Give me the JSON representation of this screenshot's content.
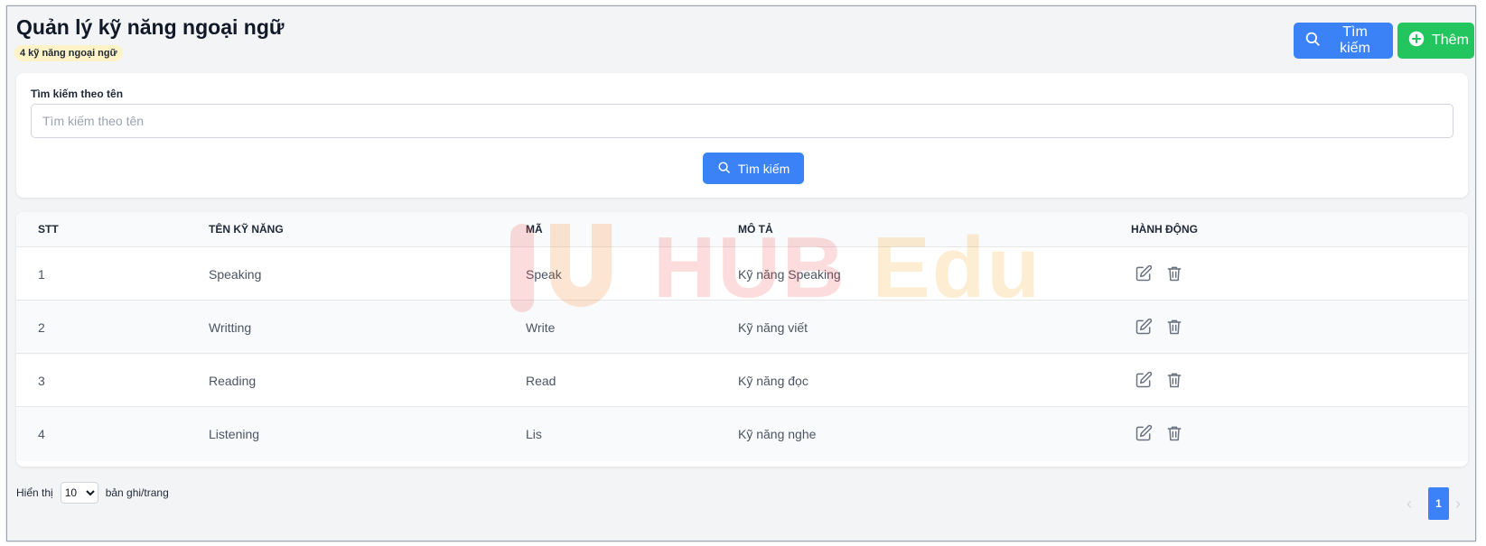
{
  "header": {
    "title": "Quản lý kỹ năng ngoại ngữ",
    "count_badge": "4 kỹ năng ngoại ngữ",
    "search_button": "Tìm kiếm",
    "add_button": "Thêm",
    "primary_color": "#3b82f6",
    "add_color": "#22c55e"
  },
  "filter": {
    "label": "Tìm kiếm theo tên",
    "input_value": "",
    "input_placeholder": "Tìm kiếm theo tên",
    "button": "Tìm kiếm"
  },
  "table": {
    "columns": [
      "STT",
      "TÊN KỸ NĂNG",
      "MÃ",
      "MÔ TẢ",
      "HÀNH ĐỘNG"
    ],
    "rows": [
      {
        "stt": "1",
        "name": "Speaking",
        "code": "Speak",
        "description": "Kỹ năng Speaking"
      },
      {
        "stt": "2",
        "name": "Writting",
        "code": "Write",
        "description": "Kỹ năng viết"
      },
      {
        "stt": "3",
        "name": "Reading",
        "code": "Read",
        "description": "Kỹ năng đọc"
      },
      {
        "stt": "4",
        "name": "Listening",
        "code": "Lis",
        "description": "Kỹ năng nghe"
      }
    ],
    "row_actions": [
      "edit-icon",
      "trash-icon"
    ]
  },
  "watermark": {
    "word_1": "HUB",
    "word_2": "Edu"
  },
  "pagination": {
    "show_label": "Hiển thị",
    "page_size": "10",
    "page_size_options": [
      "10"
    ],
    "suffix_label": "bản ghi/trang",
    "current_page": "1",
    "prev_icon": "chevron-left-icon",
    "next_icon": "chevron-right-icon"
  }
}
